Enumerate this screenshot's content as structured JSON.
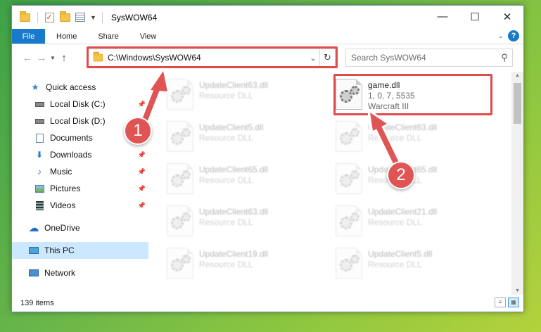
{
  "window": {
    "title": "SysWOW64"
  },
  "ribbon": {
    "file": "File",
    "tabs": [
      "Home",
      "Share",
      "View"
    ],
    "help": "?"
  },
  "address": {
    "path": "C:\\Windows\\SysWOW64",
    "search_placeholder": "Search SysWOW64"
  },
  "sidebar": {
    "items": [
      {
        "label": "Quick access",
        "icon": "star-icon"
      },
      {
        "label": "Local Disk (C:)",
        "icon": "disk-icon"
      },
      {
        "label": "Local Disk (D:)",
        "icon": "disk-icon"
      },
      {
        "label": "Documents",
        "icon": "documents-icon"
      },
      {
        "label": "Downloads",
        "icon": "downloads-icon"
      },
      {
        "label": "Music",
        "icon": "music-icon"
      },
      {
        "label": "Pictures",
        "icon": "pictures-icon"
      },
      {
        "label": "Videos",
        "icon": "videos-icon"
      },
      {
        "label": "OneDrive",
        "icon": "cloud-icon"
      },
      {
        "label": "This PC",
        "icon": "pc-icon"
      },
      {
        "label": "Network",
        "icon": "network-icon"
      }
    ]
  },
  "files": {
    "left": [
      {
        "name": "UpdateClient63.dll",
        "type": "Resource DLL"
      },
      {
        "name": "UpdateClient5.dll",
        "type": "Resource DLL"
      },
      {
        "name": "UpdateClient65.dll",
        "type": "Resource DLL"
      },
      {
        "name": "UpdateClient63.dll",
        "type": "Resource DLL"
      },
      {
        "name": "UpdateClient19.dll",
        "type": "Resource DLL"
      }
    ],
    "right": [
      {
        "name": "UpdateClient63.dll",
        "type": "Resource DLL"
      },
      {
        "name": "UpdateClient65.dll",
        "type": "Resource DLL"
      },
      {
        "name": "UpdateClient21.dll",
        "type": "Resource DLL"
      },
      {
        "name": "UpdateClient5.dll",
        "type": "Resource DLL"
      }
    ],
    "game": {
      "name": "game.dll",
      "version": "1, 0, 7, 5535",
      "product": "Warcraft III"
    }
  },
  "status": {
    "count": "139 items"
  },
  "annotations": {
    "step1": "1",
    "step2": "2"
  }
}
